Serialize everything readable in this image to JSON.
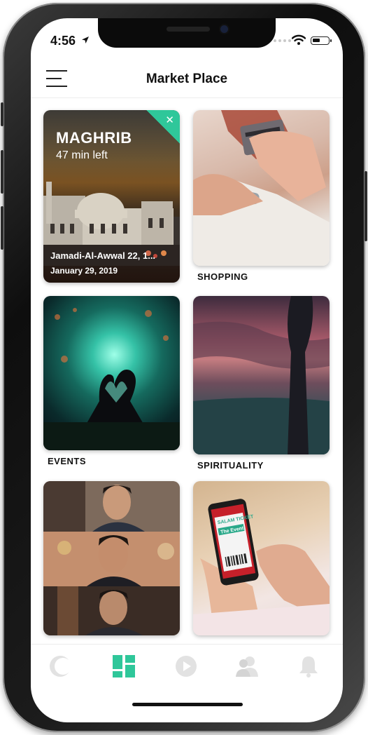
{
  "status_bar": {
    "time": "4:56"
  },
  "header": {
    "title": "Market Place"
  },
  "prayer_card": {
    "name": "MAGHRIB",
    "remaining": "47 min left",
    "hijri_date": "Jamadi-Al-Awwal 22, 1...",
    "gregorian_date": "January 29, 2019",
    "close_symbol": "✕"
  },
  "tiles": {
    "shopping": "SHOPPING",
    "events": "EVENTS",
    "spirituality": "SPIRITUALITY"
  },
  "ticket_image_text": {
    "brand": "SALAM TICKET",
    "line": "The Event"
  },
  "colors": {
    "accent": "#2fc79a",
    "tab_inactive": "#e2e2e2"
  },
  "tabbar": {
    "items": [
      {
        "icon": "moon-icon",
        "active": false
      },
      {
        "icon": "grid-icon",
        "active": true
      },
      {
        "icon": "play-icon",
        "active": false
      },
      {
        "icon": "users-icon",
        "active": false
      },
      {
        "icon": "bell-icon",
        "active": false
      }
    ]
  }
}
